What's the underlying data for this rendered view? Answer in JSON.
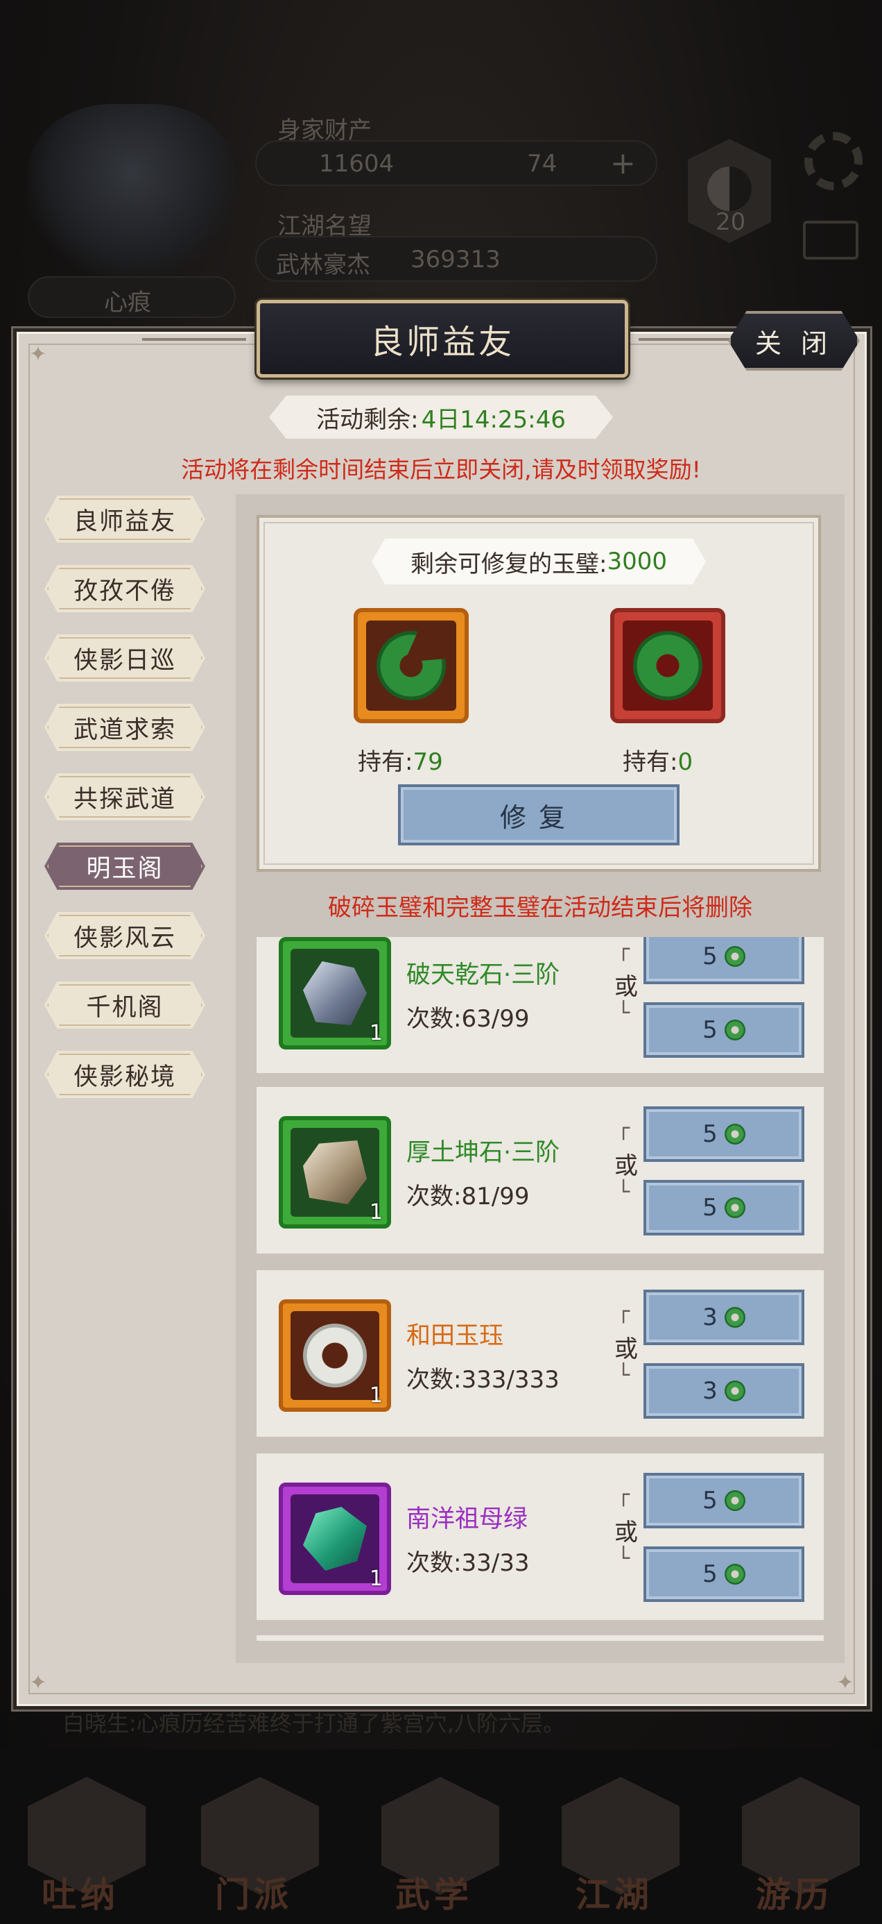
{
  "background": {
    "assets_label": "身家财产",
    "gold": "11604",
    "jade": "74",
    "fame_label": "江湖名望",
    "fame_title": "武林豪杰",
    "fame_value": "369313",
    "level": "20",
    "char_name": "心痕",
    "marquee": "白晓生:心痕历经苦难终于打通了紫宫穴,八阶六层。",
    "nav": [
      "吐纳",
      "门派",
      "武学",
      "江湖",
      "游历"
    ]
  },
  "modal": {
    "title": "良师益友",
    "close_label": "关 闭",
    "timer_label": "活动剩余:",
    "timer_value": "4日14:25:46",
    "warning": "活动将在剩余时间结束后立即关闭,请及时领取奖励!"
  },
  "tabs": [
    {
      "label": "良师益友",
      "active": false
    },
    {
      "label": "孜孜不倦",
      "active": false
    },
    {
      "label": "侠影日巡",
      "active": false
    },
    {
      "label": "武道求索",
      "active": false
    },
    {
      "label": "共探武道",
      "active": false
    },
    {
      "label": "明玉阁",
      "active": true
    },
    {
      "label": "侠影风云",
      "active": false
    },
    {
      "label": "千机阁",
      "active": false
    },
    {
      "label": "侠影秘境",
      "active": false
    }
  ],
  "repair": {
    "remain_label": "剩余可修复的玉璧:",
    "remain_value": "3000",
    "broken_hold_label": "持有:",
    "broken_hold_value": "79",
    "whole_hold_label": "持有:",
    "whole_hold_value": "0",
    "button_label": "修复"
  },
  "notice": "破碎玉璧和完整玉璧在活动结束后将删除",
  "or_label": "或",
  "items": [
    {
      "name": "破天乾石·三阶",
      "count_label": "次数:",
      "count": "63/99",
      "qty": "1",
      "price_a": "5",
      "price_b": "5",
      "rarity": "green",
      "icon": "rock-blue-icon"
    },
    {
      "name": "厚土坤石·三阶",
      "count_label": "次数:",
      "count": "81/99",
      "qty": "1",
      "price_a": "5",
      "price_b": "5",
      "rarity": "green",
      "icon": "rock-gold-icon"
    },
    {
      "name": "和田玉珏",
      "count_label": "次数:",
      "count": "333/333",
      "qty": "1",
      "price_a": "3",
      "price_b": "3",
      "rarity": "orange",
      "icon": "white-jade-ring-icon"
    },
    {
      "name": "南洋祖母绿",
      "count_label": "次数:",
      "count": "33/33",
      "qty": "1",
      "price_a": "5",
      "price_b": "5",
      "rarity": "purple",
      "icon": "emerald-icon"
    }
  ]
}
